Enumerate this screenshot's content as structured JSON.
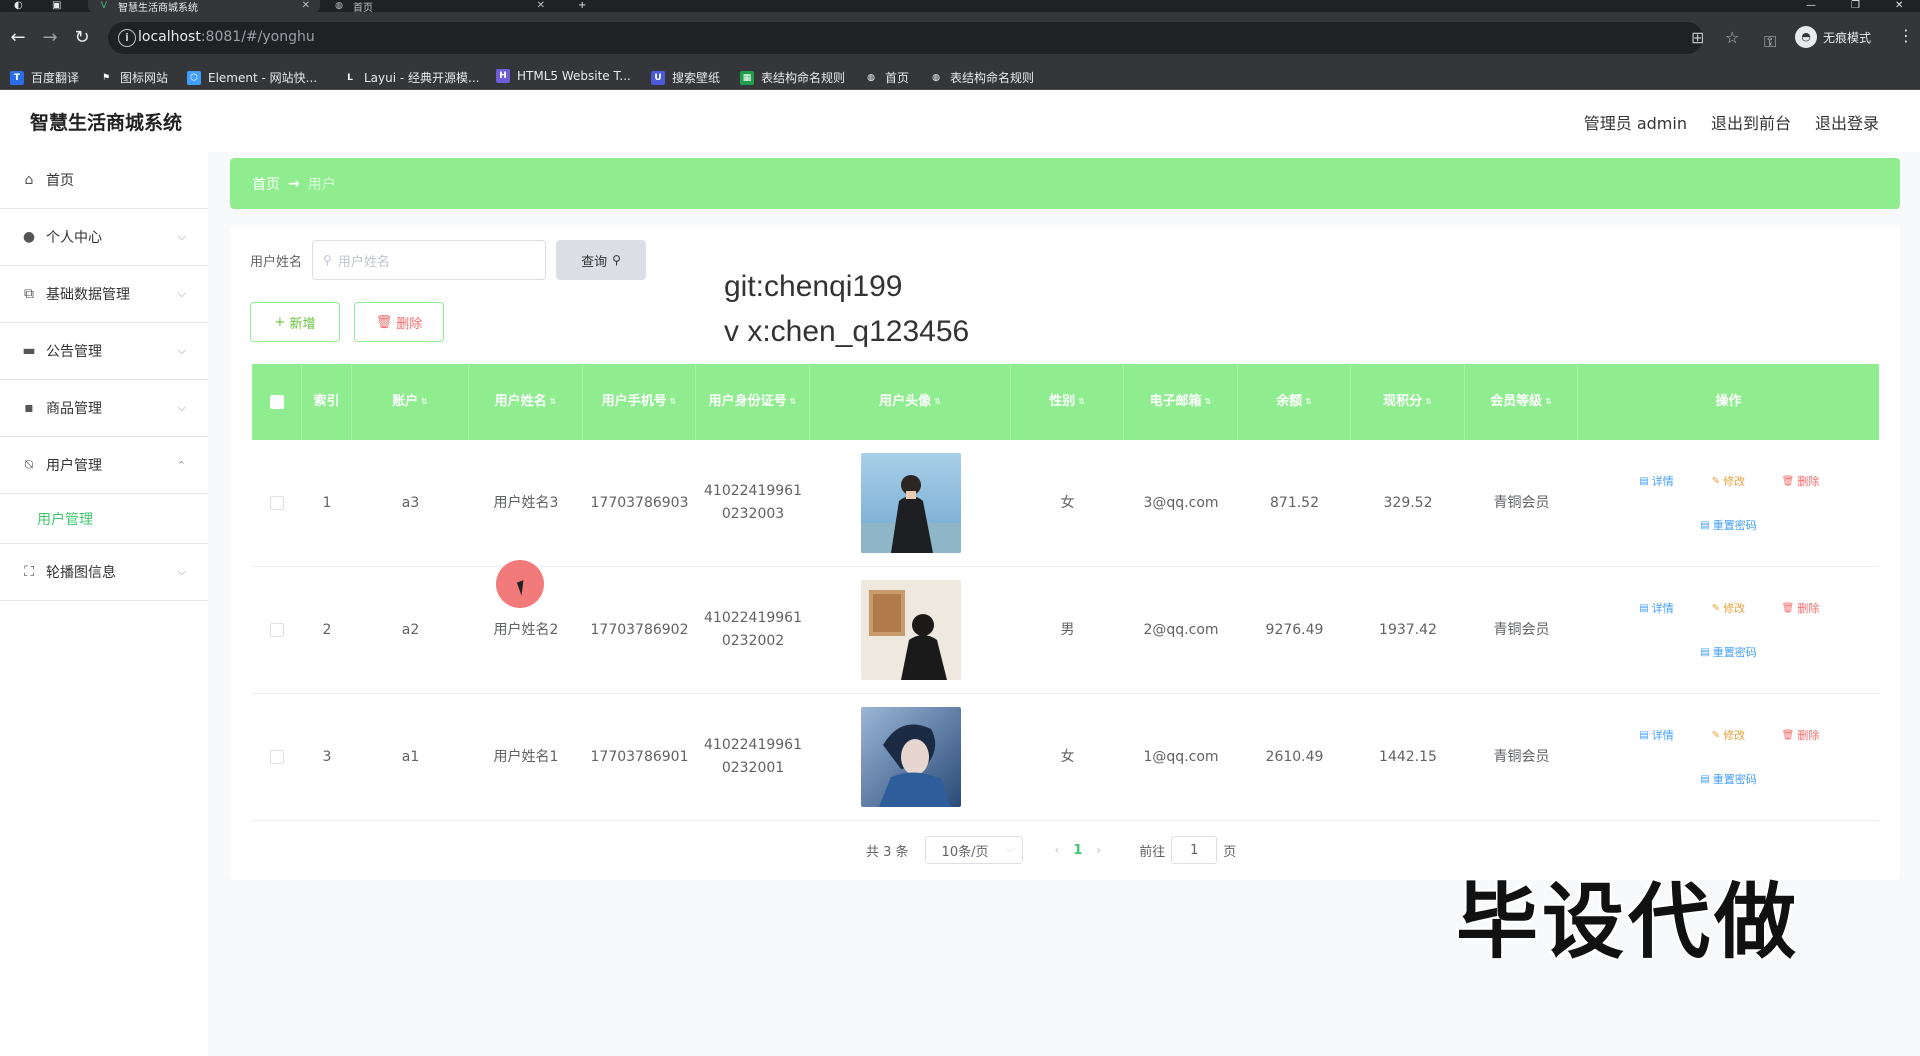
{
  "browser": {
    "active_tab_title": "智慧生活商城系统",
    "inactive_tab_title": "首页",
    "url_host": "localhost",
    "url_path": ":8081/#/yonghu",
    "incognito_label": "无痕模式",
    "bookmarks": [
      "百度翻译",
      "图标网站",
      "Element - 网站快...",
      "Layui - 经典开源模...",
      "HTML5 Website T...",
      "搜索壁纸",
      "表结构命名规则",
      "首页",
      "表结构命名规则"
    ]
  },
  "header": {
    "title": "智慧生活商城系统",
    "admin_label": "管理员 admin",
    "front_link": "退出到前台",
    "logout_link": "退出登录"
  },
  "sidebar": {
    "items": [
      {
        "label": "首页",
        "icon": "home-icon"
      },
      {
        "label": "个人中心",
        "icon": "user-icon"
      },
      {
        "label": "基础数据管理",
        "icon": "copy-icon"
      },
      {
        "label": "公告管理",
        "icon": "notice-icon"
      },
      {
        "label": "商品管理",
        "icon": "monitor-icon"
      },
      {
        "label": "用户管理",
        "icon": "user-off-icon"
      },
      {
        "label": "轮播图信息",
        "icon": "fullscreen-icon"
      }
    ],
    "submenu_active": "用户管理"
  },
  "breadcrumb": {
    "home": "首页",
    "separator": "→",
    "current": "用户"
  },
  "search": {
    "label": "用户姓名",
    "placeholder": "用户姓名",
    "button": "查询"
  },
  "actions": {
    "add": "新增",
    "delete": "删除"
  },
  "watermark": {
    "line1": "git:chenqi199",
    "line2": "v x:chen_q123456"
  },
  "table": {
    "columns": [
      "索引",
      "账户",
      "用户姓名",
      "用户手机号",
      "用户身份证号",
      "用户头像",
      "性别",
      "电子邮箱",
      "余额",
      "现积分",
      "会员等级",
      "操作"
    ],
    "rows": [
      {
        "index": "1",
        "account": "a3",
        "name": "用户姓名3",
        "phone": "17703786903",
        "id_card_1": "41022419961",
        "id_card_2": "0232003",
        "gender": "女",
        "email": "3@qq.com",
        "balance": "871.52",
        "points": "329.52",
        "level": "青铜会员"
      },
      {
        "index": "2",
        "account": "a2",
        "name": "用户姓名2",
        "phone": "17703786902",
        "id_card_1": "41022419961",
        "id_card_2": "0232002",
        "gender": "男",
        "email": "2@qq.com",
        "balance": "9276.49",
        "points": "1937.42",
        "level": "青铜会员"
      },
      {
        "index": "3",
        "account": "a1",
        "name": "用户姓名1",
        "phone": "17703786901",
        "id_card_1": "41022419961",
        "id_card_2": "0232001",
        "gender": "女",
        "email": "1@qq.com",
        "balance": "2610.49",
        "points": "1442.15",
        "level": "青铜会员"
      }
    ],
    "ops": {
      "detail": "详情",
      "edit": "修改",
      "delete": "删除",
      "reset": "重置密码"
    }
  },
  "pagination": {
    "total": "共 3 条",
    "page_size": "10条/页",
    "current_page": "1",
    "goto_label": "前往",
    "goto_value": "1",
    "goto_suffix": "页"
  },
  "promo_text": "毕设代做",
  "colors": {
    "brand_green": "#8fec8f",
    "active_green": "#3ec96e",
    "danger": "#f56c6c",
    "warning": "#e6a23c",
    "primary": "#409eff"
  }
}
